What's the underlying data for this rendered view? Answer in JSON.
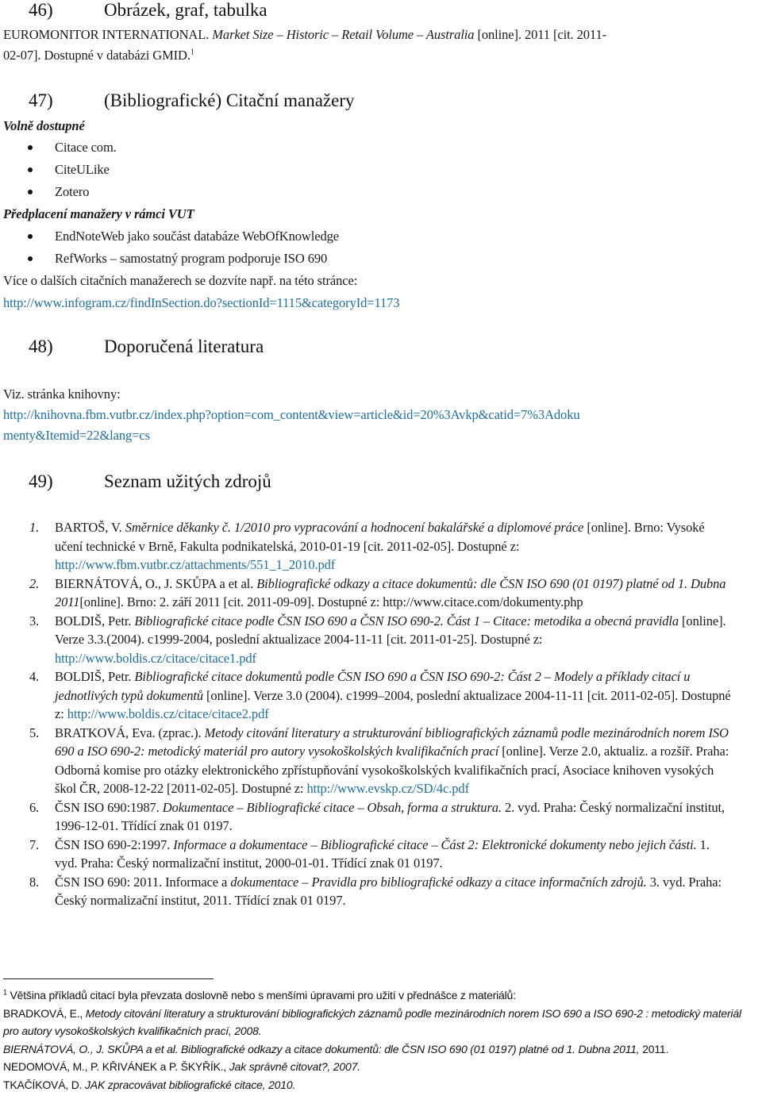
{
  "sec46": {
    "num": "46)",
    "title": "Obrázek, graf, tabulka",
    "ref_author": "EUROMONITOR INTERNATIONAL. ",
    "ref_title": "Market Size – Historic – Retail Volume – Australia",
    "ref_rest1": " [online]. 2011 [cit. 2011-",
    "ref_rest2": "02-07]. Dostupné v databázi GMID.",
    "footnote_mark": "1"
  },
  "sec47": {
    "num": "47)",
    "title": "(Bibliografické) Citační manažery",
    "group1_label": "Volně dostupné",
    "group1_items": [
      "Citace com.",
      "CiteULike",
      "Zotero"
    ],
    "group2_label": "Předplacení manažery v rámci VUT",
    "group2_items": [
      "EndNoteWeb jako součást databáze WebOfKnowledge",
      "RefWorks – samostatný program podporuje ISO 690"
    ],
    "more_text": "Více o dalších citačních manažerech se dozvíte např. na této stránce:",
    "more_link": "http://www.infogram.cz/findInSection.do?sectionId=1115&categoryId=1173"
  },
  "sec48": {
    "num": "48)",
    "title": "Doporučená literatura",
    "text": "Viz. stránka knihovny:",
    "link_line1": "http://knihovna.fbm.vutbr.cz/index.php?option=com_content&view=article&id=20%3Avkp&catid=7%3Adoku",
    "link_line2": "menty&Itemid=22&lang=cs"
  },
  "sec49": {
    "num": "49)",
    "title": "Seznam užitých zdrojů",
    "refs": [
      {
        "n": "1.",
        "a": "BARTOŠ, V. ",
        "t": "Směrnice děkanky č. 1/2010 pro vypracování a hodnocení bakalářské a diplomové práce",
        "r": " [online]. Brno: Vysoké učení technické v Brně, Fakulta podnikatelská, 2010-01-19 [cit. 2011-02-05]. Dostupné z: ",
        "link": "http://www.fbm.vutbr.cz/attachments/551_1_2010.pdf"
      },
      {
        "n": "2.",
        "a": "BIERNÁTOVÁ, O., J. SKŮPA a et al. ",
        "t": "Bibliografické odkazy a citace dokumentů: dle ČSN ISO 690 (01 0197) platné od 1. Dubna 2011",
        "r": "[online].   Brno: 2. září 2011 [cit. 2011-09-09]. Dostupné z: http://www.citace.com/dokumenty.php",
        "link": ""
      },
      {
        "n": "3.",
        "a": "BOLDIŠ, Petr. ",
        "t": "Bibliografické citace podle ČSN ISO 690 a ČSN ISO 690-2. Část 1 – Citace: metodika a obecná pravidla",
        "r": " [online]. Verze 3.3.(2004). c1999-2004, poslední aktualizace 2004-11-11 [cit. 2011-01-25]. Dostupné z: ",
        "link": "http://www.boldis.cz/citace/citace1.pdf"
      },
      {
        "n": "4.",
        "a": "BOLDIŠ, Petr. ",
        "t": "Bibliografické citace dokumentů podle ČSN ISO 690 a ČSN ISO 690-2: Část 2 – Modely a příklady citací u jednotlivých typů dokumentů",
        "r": " [online]. Verze 3.0 (2004). c1999–2004, poslední aktualizace 2004-11-11 [cit. 2011-02-05]. Dostupné z: ",
        "link": "http://www.boldis.cz/citace/citace2.pdf"
      },
      {
        "n": "5.",
        "a": "BRATKOVÁ, Eva. (zprac.). ",
        "t": "Metody citování literatury a strukturování bibliografických záznamů podle mezinárodních norem ISO 690 a ISO 690-2: metodický materiál pro autory vysokoškolských kvalifikačních prací",
        "r": " [online]. Verze 2.0, aktualiz. a rozšíř. Praha: Odborná komise pro otázky elektronického zpřístupňování vysokoškolských kvalifikačních prací, Asociace knihoven vysokých škol ČR, 2008-12-22 [2011-02-05].  Dostupné z: ",
        "link": "http://www.evskp.cz/SD/4c.pdf"
      },
      {
        "n": "6.",
        "a": "ČSN ISO 690:1987. ",
        "t": "Dokumentace – Bibliografické citace – Obsah, forma a struktura.",
        "r": " 2. vyd. Praha: Český normalizační institut, 1996-12-01.  Třídící znak 01 0197.",
        "link": ""
      },
      {
        "n": "7.",
        "a": "ČSN ISO 690-2:1997. ",
        "t": "Informace a dokumentace – Bibliografické citace – Část 2: Elektronické dokumenty nebo jejich části.",
        "r": " 1. vyd. Praha: Český normalizační institut, 2000-01-01. Třídící znak 01 0197.",
        "link": ""
      },
      {
        "n": "8.",
        "a": "ČSN ISO 690: 2011. Informace a ",
        "t": "dokumentace – Pravidla pro bibliografické odkazy a citace informačních zdrojů.",
        "r": " 3. vyd. Praha: Český normalizační institut, 2011.  Třídící znak 01 0197.",
        "link": ""
      }
    ]
  },
  "footnote": {
    "mark": "1",
    "intro": " Většina příkladů citací byla převzata doslovně nebo s menšími úpravami pro užití v přednášce z materiálů:",
    "lines": [
      {
        "a": "BRADKOVÁ, E., ",
        "t": "Metody citování literatury a strukturování bibliografických záznamů podle mezinárodních norem ISO 690 a ISO 690-2 : metodický materiál pro autory vysokoškolských kvalifikačních prací, 2008."
      },
      {
        "a": "",
        "t": "BIERNÁTOVÁ, O., J. SKŮPA a et al. Bibliografické odkazy a citace dokumentů: dle ČSN ISO 690 (01 0197) platné od 1. Dubna 2011, ",
        "r": "2011."
      },
      {
        "a": "NEDOMOVÁ, M., P. KŘIVÁNEK a P. ŠKYŘÍK., ",
        "t": "Jak správně citovat?, 2007."
      },
      {
        "a": "TKAČÍKOVÁ, D. ",
        "t": "JAK zpracovávat bibliografické citace, 2010."
      }
    ]
  }
}
